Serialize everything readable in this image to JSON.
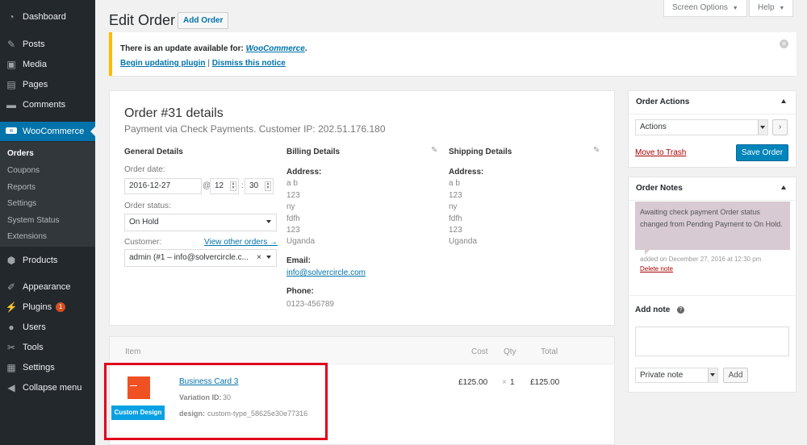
{
  "sidebar": {
    "items": [
      {
        "label": "Dashboard",
        "icon": "dashboard-icon"
      },
      {
        "label": "Posts",
        "icon": "pin-icon"
      },
      {
        "label": "Media",
        "icon": "media-icon"
      },
      {
        "label": "Pages",
        "icon": "pages-icon"
      },
      {
        "label": "Comments",
        "icon": "comments-icon"
      },
      {
        "label": "WooCommerce",
        "icon": "woocommerce-icon"
      },
      {
        "label": "Products",
        "icon": "products-icon"
      },
      {
        "label": "Appearance",
        "icon": "appearance-icon"
      },
      {
        "label": "Plugins",
        "icon": "plugins-icon",
        "badge": "1"
      },
      {
        "label": "Users",
        "icon": "users-icon"
      },
      {
        "label": "Tools",
        "icon": "tools-icon"
      },
      {
        "label": "Settings",
        "icon": "settings-icon"
      },
      {
        "label": "Collapse menu",
        "icon": "collapse-icon"
      }
    ],
    "submenu": [
      "Orders",
      "Coupons",
      "Reports",
      "Settings",
      "System Status",
      "Extensions"
    ]
  },
  "header": {
    "title": "Edit Order",
    "add_order_label": "Add Order",
    "screen_options_label": "Screen Options",
    "help_label": "Help"
  },
  "notice": {
    "text": "There is an update available for: ",
    "plugin_name": "WooCommerce",
    "period": ".",
    "begin_update_label": "Begin updating plugin",
    "separator": "|",
    "dismiss_label": "Dismiss this notice"
  },
  "order": {
    "title": "Order #31 details",
    "meta": "Payment via Check Payments. Customer IP: 202.51.176.180",
    "general": {
      "heading": "General Details",
      "date_label": "Order date:",
      "date": "2016-12-27",
      "at": "@",
      "hour": "12",
      "colon": ":",
      "minute": "30",
      "status_label": "Order status:",
      "status": "On Hold",
      "customer_label": "Customer:",
      "view_orders_label": "View other orders →",
      "customer": "admin (#1 – info@solvercircle.c...",
      "clear_symbol": "×"
    },
    "billing": {
      "heading": "Billing Details",
      "address_label": "Address:",
      "address_lines": [
        "a b",
        "123",
        "ny",
        "fdfh",
        "123",
        "Uganda"
      ],
      "email_label": "Email:",
      "email": "info@solvercircle.com",
      "phone_label": "Phone:",
      "phone": "0123-456789"
    },
    "shipping": {
      "heading": "Shipping Details",
      "address_label": "Address:",
      "address_lines": [
        "a b",
        "123",
        "ny",
        "fdfh",
        "123",
        "Uganda"
      ]
    }
  },
  "items": {
    "headers": {
      "item": "Item",
      "cost": "Cost",
      "qty": "Qty",
      "total": "Total"
    },
    "rows": [
      {
        "name": "Business Card 3",
        "variation_label": "Variation ID:",
        "variation_id": "30",
        "design_label": "design:",
        "design_value": "custom-type_58625e30e77316",
        "badge": "Custom Design",
        "cost": "£125.00",
        "qty_symbol": "×",
        "qty": "1",
        "total": "£125.00"
      }
    ]
  },
  "order_actions": {
    "title": "Order Actions",
    "select_value": "Actions",
    "go_label": "›",
    "trash_label": "Move to Trash",
    "save_label": "Save Order"
  },
  "order_notes": {
    "title": "Order Notes",
    "note_text": "Awaiting check payment Order status changed from Pending Payment to On Hold.",
    "note_meta": "added on December 27, 2016 at 12:30 pm",
    "delete_label": "Delete note",
    "add_note_label": "Add note",
    "help_symbol": "?",
    "note_type": "Private note",
    "add_button_label": "Add"
  },
  "colors": {
    "sidebar_bg": "#23282d",
    "accent": "#0073aa",
    "primary_button": "#0085ba",
    "notice_border": "#ffb900",
    "highlight_border": "#e0001b",
    "note_bg": "#d7cad2"
  }
}
